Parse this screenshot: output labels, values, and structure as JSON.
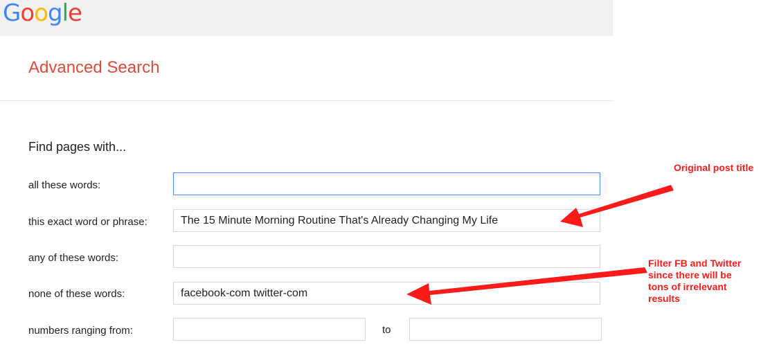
{
  "logo": {
    "letters": [
      "G",
      "o",
      "o",
      "g",
      "l",
      "e"
    ]
  },
  "page": {
    "title": "Advanced Search",
    "section_heading": "Find pages with..."
  },
  "rows": [
    {
      "label": "all these words:",
      "value": ""
    },
    {
      "label": "this exact word or phrase:",
      "value": "The 15 Minute Morning Routine That's Already Changing My Life"
    },
    {
      "label": "any of these words:",
      "value": ""
    },
    {
      "label": "none of these words:",
      "value": "facebook-com twitter-com"
    },
    {
      "label": "numbers ranging from:",
      "from_value": "",
      "to_label": "to",
      "to_value": ""
    }
  ],
  "annotations": {
    "original_title": "Original post title",
    "filter_note": [
      "Filter FB and Twitter",
      "since there will be",
      "tons of irrelevant",
      "results"
    ]
  },
  "colors": {
    "title_red": "#dd4b39",
    "annotation_red": "#ff1a1a",
    "focus_blue": "#4d90fe",
    "header_gray": "#f1f1f1"
  }
}
